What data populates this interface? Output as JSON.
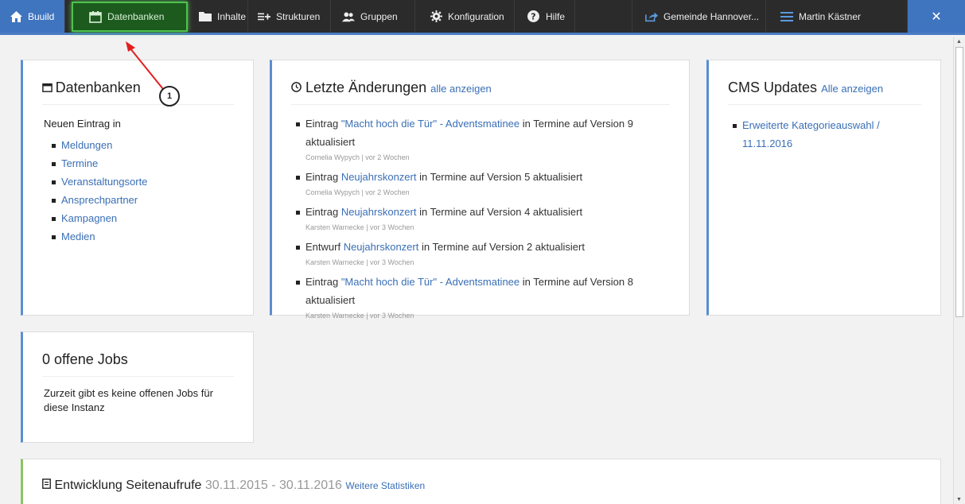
{
  "nav": {
    "home": "Buuild",
    "datenbanken": "Datenbanken",
    "inhalte": "Inhalte",
    "strukturen": "Strukturen",
    "gruppen": "Gruppen",
    "konfiguration": "Konfiguration",
    "hilfe": "Hilfe",
    "gemeinde": "Gemeinde Hannover...",
    "user": "Martin Kästner",
    "close": "✕"
  },
  "databases": {
    "title": "Datenbanken",
    "subtitle": "Neuen Eintrag in",
    "items": [
      "Meldungen",
      "Termine",
      "Veranstaltungsorte",
      "Ansprechpartner",
      "Kampagnen",
      "Medien"
    ]
  },
  "changes": {
    "title": "Letzte Änderungen",
    "link": "alle anzeigen",
    "items": [
      {
        "prefix": "Eintrag ",
        "link": "\"Macht hoch die Tür\" - Adventsmatinee",
        "suffix": " in Termine auf Version 9 aktualisiert",
        "meta": "Cornelia Wypych | vor 2 Wochen"
      },
      {
        "prefix": "Eintrag ",
        "link": "Neujahrskonzert",
        "suffix": " in Termine auf Version 5 aktualisiert",
        "meta": "Cornelia Wypych | vor 2 Wochen"
      },
      {
        "prefix": "Eintrag ",
        "link": "Neujahrskonzert",
        "suffix": " in Termine auf Version 4 aktualisiert",
        "meta": "Karsten Warnecke | vor 3 Wochen"
      },
      {
        "prefix": "Entwurf ",
        "link": "Neujahrskonzert",
        "suffix": " in Termine auf Version 2 aktualisiert",
        "meta": "Karsten Warnecke | vor 3 Wochen"
      },
      {
        "prefix": "Eintrag ",
        "link": "\"Macht hoch die Tür\" - Adventsmatinee",
        "suffix": " in Termine auf Version 8 aktualisiert",
        "meta": "Karsten Warnecke | vor 3 Wochen"
      }
    ]
  },
  "cms": {
    "title": "CMS Updates",
    "link": "Alle anzeigen",
    "items": [
      "Erweiterte Kategorieauswahl / 11.11.2016"
    ]
  },
  "jobs": {
    "title": "0 offene Jobs",
    "text": "Zurzeit gibt es keine offenen Jobs für diese Instanz"
  },
  "stats": {
    "title": "Entwicklung Seitenaufrufe",
    "range": "30.11.2015 - 30.11.2016",
    "link": "Weitere Statistiken"
  },
  "annotation": {
    "label": "1"
  },
  "colors": {
    "nav_bg": "#2b2b2b",
    "accent": "#3f74bf",
    "highlight": "#4ec24e",
    "link": "#3a6fb6",
    "arrow": "#e02020"
  }
}
